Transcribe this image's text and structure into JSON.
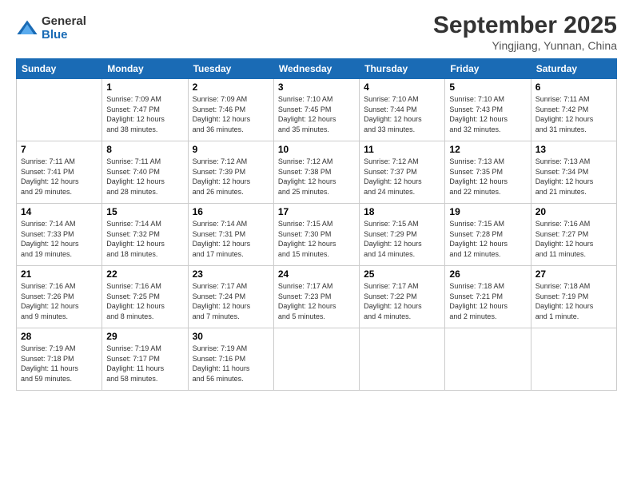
{
  "logo": {
    "general": "General",
    "blue": "Blue"
  },
  "title": "September 2025",
  "location": "Yingjiang, Yunnan, China",
  "days_of_week": [
    "Sunday",
    "Monday",
    "Tuesday",
    "Wednesday",
    "Thursday",
    "Friday",
    "Saturday"
  ],
  "weeks": [
    [
      {
        "day": "",
        "info": ""
      },
      {
        "day": "1",
        "info": "Sunrise: 7:09 AM\nSunset: 7:47 PM\nDaylight: 12 hours\nand 38 minutes."
      },
      {
        "day": "2",
        "info": "Sunrise: 7:09 AM\nSunset: 7:46 PM\nDaylight: 12 hours\nand 36 minutes."
      },
      {
        "day": "3",
        "info": "Sunrise: 7:10 AM\nSunset: 7:45 PM\nDaylight: 12 hours\nand 35 minutes."
      },
      {
        "day": "4",
        "info": "Sunrise: 7:10 AM\nSunset: 7:44 PM\nDaylight: 12 hours\nand 33 minutes."
      },
      {
        "day": "5",
        "info": "Sunrise: 7:10 AM\nSunset: 7:43 PM\nDaylight: 12 hours\nand 32 minutes."
      },
      {
        "day": "6",
        "info": "Sunrise: 7:11 AM\nSunset: 7:42 PM\nDaylight: 12 hours\nand 31 minutes."
      }
    ],
    [
      {
        "day": "7",
        "info": "Sunrise: 7:11 AM\nSunset: 7:41 PM\nDaylight: 12 hours\nand 29 minutes."
      },
      {
        "day": "8",
        "info": "Sunrise: 7:11 AM\nSunset: 7:40 PM\nDaylight: 12 hours\nand 28 minutes."
      },
      {
        "day": "9",
        "info": "Sunrise: 7:12 AM\nSunset: 7:39 PM\nDaylight: 12 hours\nand 26 minutes."
      },
      {
        "day": "10",
        "info": "Sunrise: 7:12 AM\nSunset: 7:38 PM\nDaylight: 12 hours\nand 25 minutes."
      },
      {
        "day": "11",
        "info": "Sunrise: 7:12 AM\nSunset: 7:37 PM\nDaylight: 12 hours\nand 24 minutes."
      },
      {
        "day": "12",
        "info": "Sunrise: 7:13 AM\nSunset: 7:35 PM\nDaylight: 12 hours\nand 22 minutes."
      },
      {
        "day": "13",
        "info": "Sunrise: 7:13 AM\nSunset: 7:34 PM\nDaylight: 12 hours\nand 21 minutes."
      }
    ],
    [
      {
        "day": "14",
        "info": "Sunrise: 7:14 AM\nSunset: 7:33 PM\nDaylight: 12 hours\nand 19 minutes."
      },
      {
        "day": "15",
        "info": "Sunrise: 7:14 AM\nSunset: 7:32 PM\nDaylight: 12 hours\nand 18 minutes."
      },
      {
        "day": "16",
        "info": "Sunrise: 7:14 AM\nSunset: 7:31 PM\nDaylight: 12 hours\nand 17 minutes."
      },
      {
        "day": "17",
        "info": "Sunrise: 7:15 AM\nSunset: 7:30 PM\nDaylight: 12 hours\nand 15 minutes."
      },
      {
        "day": "18",
        "info": "Sunrise: 7:15 AM\nSunset: 7:29 PM\nDaylight: 12 hours\nand 14 minutes."
      },
      {
        "day": "19",
        "info": "Sunrise: 7:15 AM\nSunset: 7:28 PM\nDaylight: 12 hours\nand 12 minutes."
      },
      {
        "day": "20",
        "info": "Sunrise: 7:16 AM\nSunset: 7:27 PM\nDaylight: 12 hours\nand 11 minutes."
      }
    ],
    [
      {
        "day": "21",
        "info": "Sunrise: 7:16 AM\nSunset: 7:26 PM\nDaylight: 12 hours\nand 9 minutes."
      },
      {
        "day": "22",
        "info": "Sunrise: 7:16 AM\nSunset: 7:25 PM\nDaylight: 12 hours\nand 8 minutes."
      },
      {
        "day": "23",
        "info": "Sunrise: 7:17 AM\nSunset: 7:24 PM\nDaylight: 12 hours\nand 7 minutes."
      },
      {
        "day": "24",
        "info": "Sunrise: 7:17 AM\nSunset: 7:23 PM\nDaylight: 12 hours\nand 5 minutes."
      },
      {
        "day": "25",
        "info": "Sunrise: 7:17 AM\nSunset: 7:22 PM\nDaylight: 12 hours\nand 4 minutes."
      },
      {
        "day": "26",
        "info": "Sunrise: 7:18 AM\nSunset: 7:21 PM\nDaylight: 12 hours\nand 2 minutes."
      },
      {
        "day": "27",
        "info": "Sunrise: 7:18 AM\nSunset: 7:19 PM\nDaylight: 12 hours\nand 1 minute."
      }
    ],
    [
      {
        "day": "28",
        "info": "Sunrise: 7:19 AM\nSunset: 7:18 PM\nDaylight: 11 hours\nand 59 minutes."
      },
      {
        "day": "29",
        "info": "Sunrise: 7:19 AM\nSunset: 7:17 PM\nDaylight: 11 hours\nand 58 minutes."
      },
      {
        "day": "30",
        "info": "Sunrise: 7:19 AM\nSunset: 7:16 PM\nDaylight: 11 hours\nand 56 minutes."
      },
      {
        "day": "",
        "info": ""
      },
      {
        "day": "",
        "info": ""
      },
      {
        "day": "",
        "info": ""
      },
      {
        "day": "",
        "info": ""
      }
    ]
  ]
}
